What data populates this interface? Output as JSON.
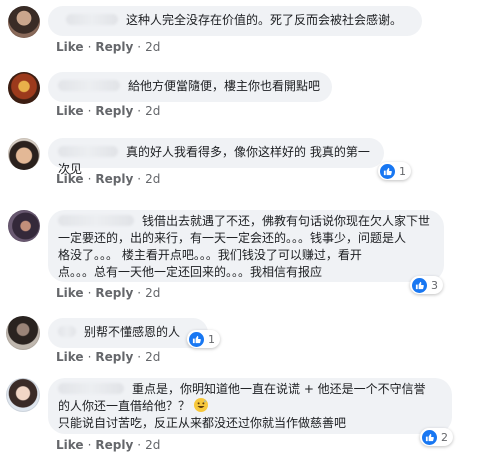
{
  "actions": {
    "like": "Like",
    "reply": "Reply",
    "sep": "·"
  },
  "comments": [
    {
      "text": "这种人完全没存在价值的。死了反而会被社会感谢。",
      "time": "2d"
    },
    {
      "text": "給他方便當隨便，樓主你也看開點吧",
      "time": "2d"
    },
    {
      "text": "真的好人我看得多，像你这样好的 我真的第一次见",
      "time": "2d",
      "reactions": "1"
    },
    {
      "lines": [
        "钱借出去就遇了不还，佛教有句话说你现在欠人家下世",
        "一定要还的，出的来行，有一天一定会还的。。。钱事少，问题是人",
        "格没了。。。 楼主看开点吧。。。我们钱没了可以赚过，看开",
        "点。。。总有一天他一定还回来的。。。我相信有报应"
      ],
      "time": "2d",
      "reactions": "3"
    },
    {
      "text": "别帮不懂感恩的人",
      "time": "2d",
      "reactions": "1"
    },
    {
      "lines": [
        "重点是，你明知道他一直在说谎 + 他还是一个不守信誉",
        "的人你还一直借给他？？",
        "只能说自讨苦吃，反正从来都没还过你就当作做慈善吧"
      ],
      "time": "2d",
      "reactions": "2"
    }
  ],
  "colors": {
    "bubble": "#f0f2f5",
    "like_blue": "#1877f2",
    "meta": "#65676b"
  }
}
